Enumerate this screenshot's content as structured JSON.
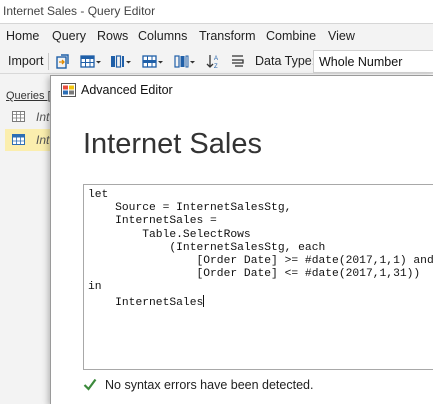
{
  "window": {
    "title": "Internet Sales - Query Editor"
  },
  "menubar": {
    "items": [
      "Home",
      "Query",
      "Rows",
      "Columns",
      "Transform",
      "Combine",
      "View"
    ]
  },
  "toolbar": {
    "import_label": "Import",
    "data_type_label": "Data Type:",
    "data_type_value": "Whole Number",
    "icons": [
      "import-table-icon",
      "table-grid-icon",
      "column-split-icon",
      "table-rows-icon",
      "column-add-icon",
      "sort-icon",
      "format-icon"
    ]
  },
  "queries": {
    "header": "Queries [",
    "items": [
      {
        "label": "Int",
        "selected": false
      },
      {
        "label": "Int",
        "selected": true
      }
    ]
  },
  "dialog": {
    "title": "Advanced Editor",
    "heading": "Internet Sales",
    "code_lines": [
      "let",
      "    Source = InternetSalesStg,",
      "    InternetSales =",
      "        Table.SelectRows",
      "            (InternetSalesStg, each",
      "                [Order Date] >= #date(2017,1,1) and",
      "                [Order Date] <= #date(2017,1,31))",
      "in",
      "    InternetSales"
    ],
    "status": "No syntax errors have been detected.",
    "status_color": "#3c8a3c"
  }
}
